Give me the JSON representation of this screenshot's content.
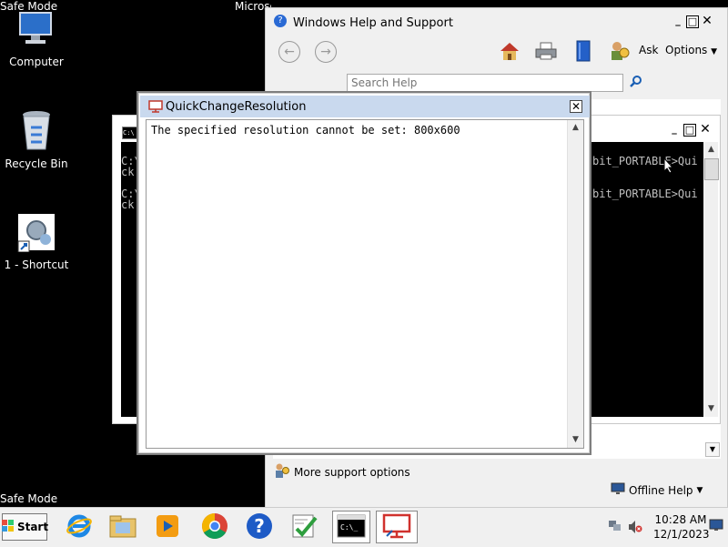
{
  "desktop": {
    "safe_mode_label": "Safe Mode",
    "icons": [
      {
        "label": "Computer",
        "icon": "computer-icon"
      },
      {
        "label": "Recycle Bin",
        "icon": "recycle-bin-icon"
      },
      {
        "label": "1 - Shortcut",
        "icon": "shortcut-icon"
      }
    ],
    "partial_title": "Microsoft (R) Windows (R) (Build 7601: Service Pack 1)"
  },
  "help_window": {
    "title": "Windows Help and Support",
    "toolbar": {
      "ask_label": "Ask",
      "options_label": "Options"
    },
    "search": {
      "placeholder": "Search Help",
      "value": ""
    },
    "more_support_label": "More support options",
    "offline_help_label": "Offline Help"
  },
  "cmd_window": {
    "visible_lines": [
      "C:\\",
      "ck",
      "C:\\",
      "ck"
    ],
    "right_lines": [
      "bit_PORTABLE>Qui",
      "bit_PORTABLE>Qui"
    ]
  },
  "dialog": {
    "title": "QuickChangeResolution",
    "message": "The specified resolution cannot be set: 800x600"
  },
  "taskbar": {
    "start_label": "Start",
    "time": "10:28 AM",
    "date": "12/1/2023",
    "apps": [
      "internet-explorer-icon",
      "explorer-folder-icon",
      "media-player-icon",
      "chrome-icon",
      "help-icon",
      "certificate-icon",
      "cmd-icon",
      "remote-display-icon"
    ]
  },
  "colors": {
    "desktop_bg": "#000000",
    "taskbar_bg": "#f0f0f0",
    "window_bg": "#ffffff"
  }
}
